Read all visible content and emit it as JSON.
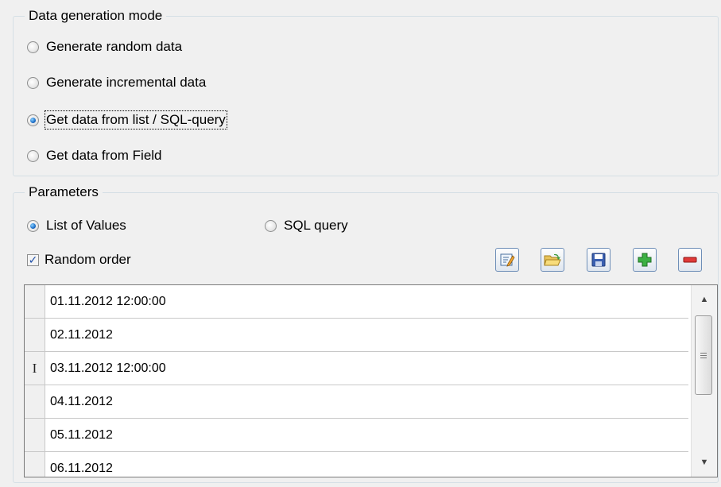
{
  "generation_mode": {
    "title": "Data generation mode",
    "options": [
      {
        "label": "Generate random data",
        "checked": false
      },
      {
        "label": "Generate incremental data",
        "checked": false
      },
      {
        "label": "Get data from list / SQL-query",
        "checked": true
      },
      {
        "label": "Get data from Field",
        "checked": false
      }
    ]
  },
  "parameters": {
    "title": "Parameters",
    "source_options": [
      {
        "label": "List of Values",
        "checked": true
      },
      {
        "label": "SQL query",
        "checked": false
      }
    ],
    "random_order": {
      "label": "Random order",
      "checked": true
    },
    "toolbar": [
      {
        "icon": "edit-icon"
      },
      {
        "icon": "open-folder-icon"
      },
      {
        "icon": "save-icon"
      },
      {
        "icon": "add-icon"
      },
      {
        "icon": "remove-icon"
      }
    ]
  },
  "values_list": {
    "rows": [
      {
        "value": "01.11.2012 12:00:00",
        "indicator": ""
      },
      {
        "value": "02.11.2012",
        "indicator": ""
      },
      {
        "value": "03.11.2012 12:00:00",
        "indicator": "I"
      },
      {
        "value": "04.11.2012",
        "indicator": ""
      },
      {
        "value": "05.11.2012",
        "indicator": ""
      },
      {
        "value": "06.11.2012",
        "indicator": ""
      }
    ]
  }
}
